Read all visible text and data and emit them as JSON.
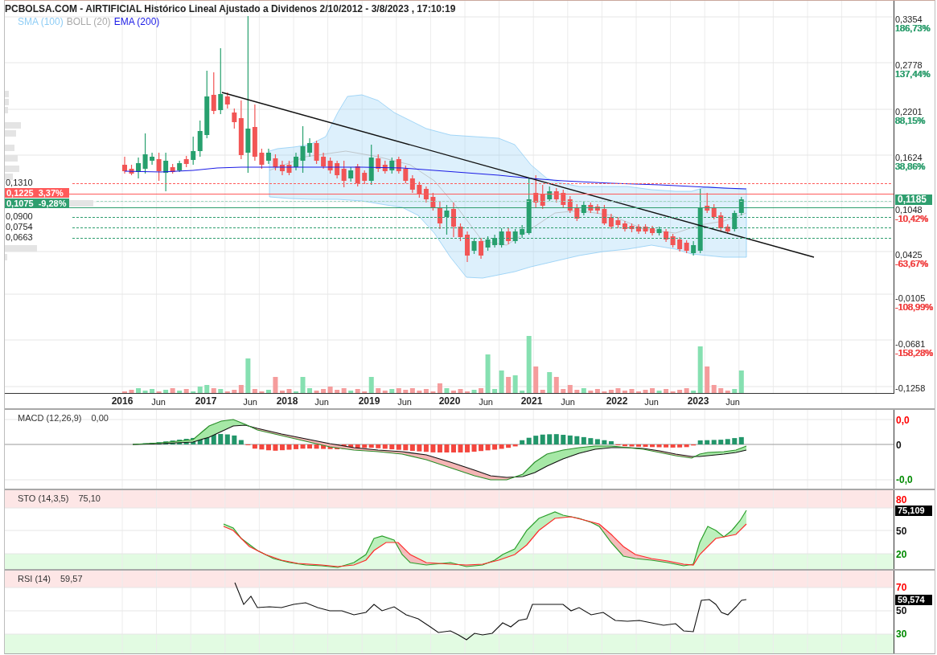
{
  "title": "PCBOLSA.COM - AIRTIFICIAL Histórico Lineal Ajustado a Dividenos 2/10/2012 - 3/8/2023 , 17:10:19",
  "legend": [
    {
      "label": "SMA (100)",
      "color": "#8ecdf5"
    },
    {
      "label": "BOLL (20)",
      "color": "#aaaaaa"
    },
    {
      "label": "EMA (200)",
      "color": "#1a1ae6"
    }
  ],
  "price_levels": [
    {
      "kind": "line",
      "price": "0,1310",
      "color": "#ff5a5a"
    },
    {
      "kind": "badge",
      "price": "0,1225",
      "change": "3,37%",
      "color": "#ff5a5a"
    },
    {
      "kind": "badge",
      "price": "0,1075",
      "change": "-9,28%",
      "color": "#2e9e6e"
    },
    {
      "kind": "line",
      "price": "0,0900",
      "color": "#2e9e6e"
    },
    {
      "kind": "line",
      "price": "0,0754",
      "color": "#2e9e6e"
    },
    {
      "kind": "line",
      "price": "0,0663",
      "color": "#2e9e6e"
    }
  ],
  "price_axis": [
    {
      "price": "0,3354",
      "change": "186,73%",
      "color": "#2e9e6e"
    },
    {
      "price": "0,2778",
      "change": "137,44%",
      "color": "#2e9e6e"
    },
    {
      "price": "0,2201",
      "change": "88,15%",
      "color": "#2e9e6e"
    },
    {
      "price": "0,1624",
      "change": "38,86%",
      "color": "#2e9e6e"
    },
    {
      "price": "0,1048",
      "change": "-10,42%",
      "color": "#f04545"
    },
    {
      "price": "0,0425",
      "change": "-63,67%",
      "color": "#f04545"
    },
    {
      "price": "-0,0105",
      "change": "-108,99%",
      "color": "#f04545"
    },
    {
      "price": "-0,0681",
      "change": "-158,28%",
      "color": "#f04545"
    },
    {
      "price": "-0,1258"
    }
  ],
  "current_price": "0,1185",
  "time_axis": [
    {
      "kind": "year",
      "label": "2016"
    },
    {
      "kind": "month",
      "label": "Jun"
    },
    {
      "kind": "year",
      "label": "2017"
    },
    {
      "kind": "month",
      "label": "Jun"
    },
    {
      "kind": "year",
      "label": "2018"
    },
    {
      "kind": "month",
      "label": "Jun"
    },
    {
      "kind": "year",
      "label": "2019"
    },
    {
      "kind": "month",
      "label": "Jun"
    },
    {
      "kind": "year",
      "label": "2020"
    },
    {
      "kind": "month",
      "label": "Jun"
    },
    {
      "kind": "year",
      "label": "2021"
    },
    {
      "kind": "month",
      "label": "Jun"
    },
    {
      "kind": "year",
      "label": "2022"
    },
    {
      "kind": "month",
      "label": "Jun"
    },
    {
      "kind": "year",
      "label": "2023"
    },
    {
      "kind": "month",
      "label": "Jun"
    }
  ],
  "indicators": [
    {
      "kind": "macd",
      "title": "MACD (12,26,9)",
      "value": "0,00",
      "axis": [
        {
          "label": "0,0",
          "color": "#ff0000"
        },
        {
          "label": "0",
          "color": "#111111"
        },
        {
          "label": "-0,0",
          "color": "#008a00"
        }
      ]
    },
    {
      "kind": "sto",
      "title": "STO (14,3,5)",
      "value": "75,10",
      "axis": [
        {
          "label": "80",
          "color": "#ff0000"
        },
        {
          "label": "50",
          "color": "#111111"
        },
        {
          "label": "20",
          "color": "#008a00"
        }
      ],
      "badge": "75,109"
    },
    {
      "kind": "rsi",
      "title": "RSI (14)",
      "value": "59,57",
      "axis": [
        {
          "label": "70",
          "color": "#ff0000"
        },
        {
          "label": "50",
          "color": "#111111"
        },
        {
          "label": "30",
          "color": "#008a00"
        }
      ],
      "badge": "59,574"
    }
  ]
}
